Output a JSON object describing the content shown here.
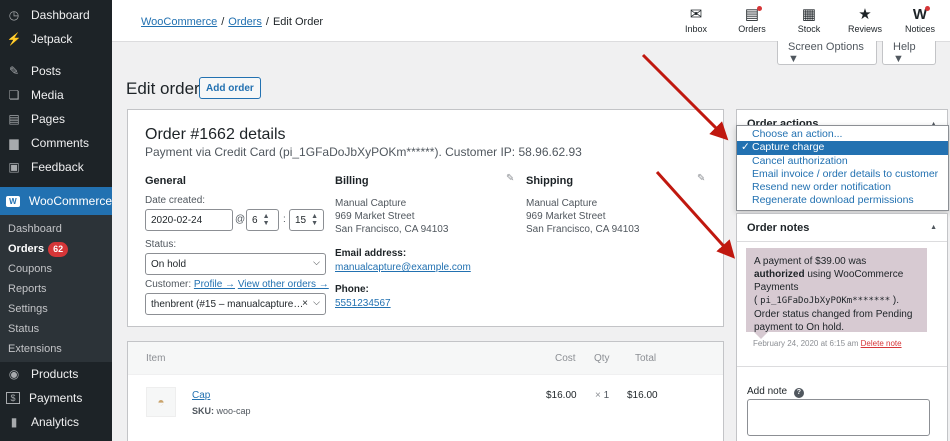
{
  "sidebar": {
    "items": [
      {
        "label": "Dashboard",
        "icon": "dashboard-icon",
        "glyph": "◷"
      },
      {
        "label": "Jetpack",
        "icon": "jetpack-icon",
        "glyph": "⚡"
      },
      {
        "label": "Posts",
        "icon": "pin-icon",
        "glyph": "✎"
      },
      {
        "label": "Media",
        "icon": "media-icon",
        "glyph": "❏"
      },
      {
        "label": "Pages",
        "icon": "pages-icon",
        "glyph": "▤"
      },
      {
        "label": "Comments",
        "icon": "comment-icon",
        "glyph": "▆"
      },
      {
        "label": "Feedback",
        "icon": "feedback-icon",
        "glyph": "▣"
      },
      {
        "label": "WooCommerce",
        "icon": "woo-icon",
        "glyph": "W"
      }
    ],
    "sub": [
      {
        "label": "Dashboard"
      },
      {
        "label": "Orders",
        "badge": "62"
      },
      {
        "label": "Coupons"
      },
      {
        "label": "Reports"
      },
      {
        "label": "Settings"
      },
      {
        "label": "Status"
      },
      {
        "label": "Extensions"
      }
    ],
    "bottom": [
      {
        "label": "Products",
        "icon": "products-icon",
        "glyph": "◉"
      },
      {
        "label": "Payments",
        "icon": "payments-icon",
        "glyph": "$"
      },
      {
        "label": "Analytics",
        "icon": "analytics-icon",
        "glyph": "▮"
      }
    ]
  },
  "breadcrumb": {
    "woo": "WooCommerce",
    "orders": "Orders",
    "current": "Edit Order",
    "sep": "/"
  },
  "toolbar": [
    {
      "label": "Inbox",
      "icon": "inbox-icon",
      "glyph": "✉",
      "dot": false
    },
    {
      "label": "Orders",
      "icon": "orders-icon",
      "glyph": "▤",
      "dot": true
    },
    {
      "label": "Stock",
      "icon": "stock-icon",
      "glyph": "▦",
      "dot": false
    },
    {
      "label": "Reviews",
      "icon": "star-icon",
      "glyph": "★",
      "dot": false
    },
    {
      "label": "Notices",
      "icon": "notices-icon",
      "glyph": "W",
      "dot": true
    }
  ],
  "screen_options": "Screen Options ▼",
  "help": "Help ▼",
  "page_title": "Edit order",
  "add_order": "Add order",
  "order": {
    "title": "Order #1662 details",
    "subtitle": "Payment via Credit Card (pi_1GFaDoJbXyPOKm******). Customer IP: 58.96.62.93",
    "general": "General",
    "date_label": "Date created:",
    "date": "2020-02-24",
    "at": "@",
    "hour": "6",
    "colon": ":",
    "minute": "15",
    "status_label": "Status:",
    "status": "On hold",
    "customer_label": "Customer:",
    "profile": "Profile →",
    "other_orders": "View other orders →",
    "customer": "thenbrent (#15 – manualcapture…",
    "clear": "×",
    "billing": {
      "title": "Billing",
      "line1": "Manual Capture",
      "line2": "969 Market Street",
      "line3": "San Francisco, CA 94103",
      "email_label": "Email address:",
      "email": "manualcapture@example.com",
      "phone_label": "Phone:",
      "phone": "5551234567"
    },
    "shipping": {
      "title": "Shipping",
      "line1": "Manual Capture",
      "line2": "969 Market Street",
      "line3": "San Francisco, CA 94103"
    }
  },
  "items": {
    "headers": {
      "item": "Item",
      "cost": "Cost",
      "qty": "Qty",
      "total": "Total"
    },
    "rows": [
      {
        "name": "Cap",
        "sku_label": "SKU:",
        "sku": "woo-cap",
        "cost": "$16.00",
        "qty_x": "×",
        "qty": "1",
        "total": "$16.00"
      }
    ]
  },
  "order_actions": {
    "title": "Order actions",
    "options": [
      "Choose an action...",
      "Capture charge",
      "Cancel authorization",
      "Email invoice / order details to customer",
      "Resend new order notification",
      "Regenerate download permissions"
    ],
    "selected_index": 1
  },
  "order_notes": {
    "title": "Order notes",
    "note": {
      "t1": "A payment of $39.00 was ",
      "t2": "authorized",
      "t3": " using WooCommerce Payments",
      "t4": "( ",
      "code": "pi_1GFaDoJbXyPOKm*******",
      "t5": " ).",
      "t6": "Order status changed from Pending payment to On hold.",
      "date": "February 24, 2020 at 6:15 am",
      "delete": "Delete note"
    },
    "add_note": "Add note",
    "help_glyph": "?"
  },
  "colors": {
    "accent": "#2271b1",
    "sidebar": "#1d2327",
    "arrow": "#c0180f",
    "note": "#d7cad2"
  }
}
